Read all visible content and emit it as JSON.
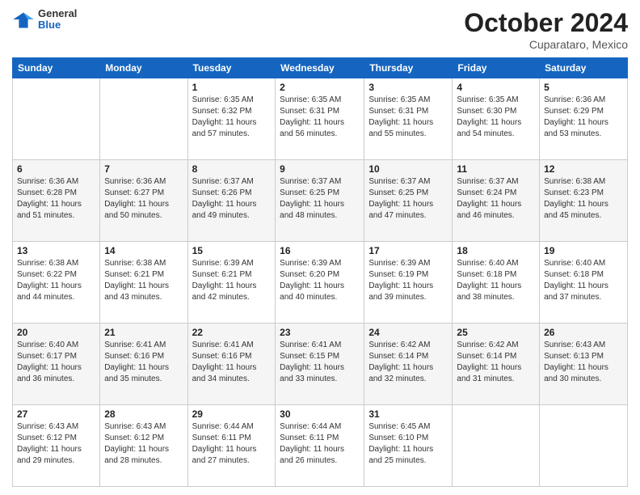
{
  "header": {
    "logo": {
      "general": "General",
      "blue": "Blue"
    },
    "title": "October 2024",
    "location": "Cuparataro, Mexico"
  },
  "weekdays": [
    "Sunday",
    "Monday",
    "Tuesday",
    "Wednesday",
    "Thursday",
    "Friday",
    "Saturday"
  ],
  "weeks": [
    [
      {
        "day": "",
        "info": ""
      },
      {
        "day": "",
        "info": ""
      },
      {
        "day": "1",
        "info": "Sunrise: 6:35 AM\nSunset: 6:32 PM\nDaylight: 11 hours and 57 minutes."
      },
      {
        "day": "2",
        "info": "Sunrise: 6:35 AM\nSunset: 6:31 PM\nDaylight: 11 hours and 56 minutes."
      },
      {
        "day": "3",
        "info": "Sunrise: 6:35 AM\nSunset: 6:31 PM\nDaylight: 11 hours and 55 minutes."
      },
      {
        "day": "4",
        "info": "Sunrise: 6:35 AM\nSunset: 6:30 PM\nDaylight: 11 hours and 54 minutes."
      },
      {
        "day": "5",
        "info": "Sunrise: 6:36 AM\nSunset: 6:29 PM\nDaylight: 11 hours and 53 minutes."
      }
    ],
    [
      {
        "day": "6",
        "info": "Sunrise: 6:36 AM\nSunset: 6:28 PM\nDaylight: 11 hours and 51 minutes."
      },
      {
        "day": "7",
        "info": "Sunrise: 6:36 AM\nSunset: 6:27 PM\nDaylight: 11 hours and 50 minutes."
      },
      {
        "day": "8",
        "info": "Sunrise: 6:37 AM\nSunset: 6:26 PM\nDaylight: 11 hours and 49 minutes."
      },
      {
        "day": "9",
        "info": "Sunrise: 6:37 AM\nSunset: 6:25 PM\nDaylight: 11 hours and 48 minutes."
      },
      {
        "day": "10",
        "info": "Sunrise: 6:37 AM\nSunset: 6:25 PM\nDaylight: 11 hours and 47 minutes."
      },
      {
        "day": "11",
        "info": "Sunrise: 6:37 AM\nSunset: 6:24 PM\nDaylight: 11 hours and 46 minutes."
      },
      {
        "day": "12",
        "info": "Sunrise: 6:38 AM\nSunset: 6:23 PM\nDaylight: 11 hours and 45 minutes."
      }
    ],
    [
      {
        "day": "13",
        "info": "Sunrise: 6:38 AM\nSunset: 6:22 PM\nDaylight: 11 hours and 44 minutes."
      },
      {
        "day": "14",
        "info": "Sunrise: 6:38 AM\nSunset: 6:21 PM\nDaylight: 11 hours and 43 minutes."
      },
      {
        "day": "15",
        "info": "Sunrise: 6:39 AM\nSunset: 6:21 PM\nDaylight: 11 hours and 42 minutes."
      },
      {
        "day": "16",
        "info": "Sunrise: 6:39 AM\nSunset: 6:20 PM\nDaylight: 11 hours and 40 minutes."
      },
      {
        "day": "17",
        "info": "Sunrise: 6:39 AM\nSunset: 6:19 PM\nDaylight: 11 hours and 39 minutes."
      },
      {
        "day": "18",
        "info": "Sunrise: 6:40 AM\nSunset: 6:18 PM\nDaylight: 11 hours and 38 minutes."
      },
      {
        "day": "19",
        "info": "Sunrise: 6:40 AM\nSunset: 6:18 PM\nDaylight: 11 hours and 37 minutes."
      }
    ],
    [
      {
        "day": "20",
        "info": "Sunrise: 6:40 AM\nSunset: 6:17 PM\nDaylight: 11 hours and 36 minutes."
      },
      {
        "day": "21",
        "info": "Sunrise: 6:41 AM\nSunset: 6:16 PM\nDaylight: 11 hours and 35 minutes."
      },
      {
        "day": "22",
        "info": "Sunrise: 6:41 AM\nSunset: 6:16 PM\nDaylight: 11 hours and 34 minutes."
      },
      {
        "day": "23",
        "info": "Sunrise: 6:41 AM\nSunset: 6:15 PM\nDaylight: 11 hours and 33 minutes."
      },
      {
        "day": "24",
        "info": "Sunrise: 6:42 AM\nSunset: 6:14 PM\nDaylight: 11 hours and 32 minutes."
      },
      {
        "day": "25",
        "info": "Sunrise: 6:42 AM\nSunset: 6:14 PM\nDaylight: 11 hours and 31 minutes."
      },
      {
        "day": "26",
        "info": "Sunrise: 6:43 AM\nSunset: 6:13 PM\nDaylight: 11 hours and 30 minutes."
      }
    ],
    [
      {
        "day": "27",
        "info": "Sunrise: 6:43 AM\nSunset: 6:12 PM\nDaylight: 11 hours and 29 minutes."
      },
      {
        "day": "28",
        "info": "Sunrise: 6:43 AM\nSunset: 6:12 PM\nDaylight: 11 hours and 28 minutes."
      },
      {
        "day": "29",
        "info": "Sunrise: 6:44 AM\nSunset: 6:11 PM\nDaylight: 11 hours and 27 minutes."
      },
      {
        "day": "30",
        "info": "Sunrise: 6:44 AM\nSunset: 6:11 PM\nDaylight: 11 hours and 26 minutes."
      },
      {
        "day": "31",
        "info": "Sunrise: 6:45 AM\nSunset: 6:10 PM\nDaylight: 11 hours and 25 minutes."
      },
      {
        "day": "",
        "info": ""
      },
      {
        "day": "",
        "info": ""
      }
    ]
  ]
}
